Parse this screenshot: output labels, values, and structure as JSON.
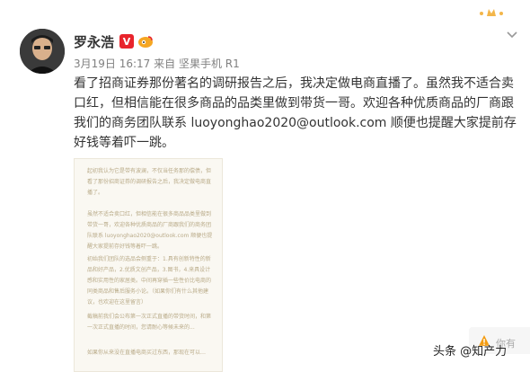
{
  "post": {
    "author": "罗永浩",
    "verified_badge": "V",
    "level_badge_icon": "weibo-member-icon",
    "timestamp": "3月19日 16:17",
    "source_prefix": "来自",
    "source": "坚果手机 R1",
    "text": "看了招商证券那份著名的调研报告之后，我决定做电商直播了。虽然我不适合卖口红，但相信能在很多商品的品类里做到带货一哥。欢迎各种优质商品的厂商跟我们的商务团队联系 luoyonghao2020@outlook.com 顺便也提醒大家提前存好钱等着吓一跳。"
  },
  "attached_image": {
    "paragraphs": [
      "起初我认为它是带有波澜，不仅当任务那的偿债，但看了那份招商证券的调研报告之后，我决定做电商直播了。",
      "虽然不适合卖口红，但相信能在很多商品品类里做到带货一哥，欢迎各种优质商品的厂商跟我们的商务团队联系 luoyonghao2020@outlook.com 顺便也提醒大家提前存好钱等着吓一跳。",
      "初始我们团队的选品会侧重于：1.具有创新特性的新品和好产品，2.优质文创产品，3.图书，4.来具设计感和实用性的家居类。中间再穿插一些性价比电商的同类商品和售后服务小论。（如果你们有什么其他建议，也欢迎在这里留言）",
      "截稿前我们会公布第一次正式直播的带货时间，和第一次正式直播的时间，您请耐心等候未来的...",
      "如果你从来没在直播电商买过东西，那现在可以…"
    ]
  },
  "watermark": "头条 @知产力",
  "side_notice": {
    "icon": "warning-icon",
    "label": "你有"
  },
  "ui_icons": {
    "menu": "chevron-down-icon",
    "decoration": "crown-dots-icon"
  },
  "colors": {
    "verified_red": "#e8242c",
    "meta_gray": "#808080",
    "text": "#333333"
  }
}
